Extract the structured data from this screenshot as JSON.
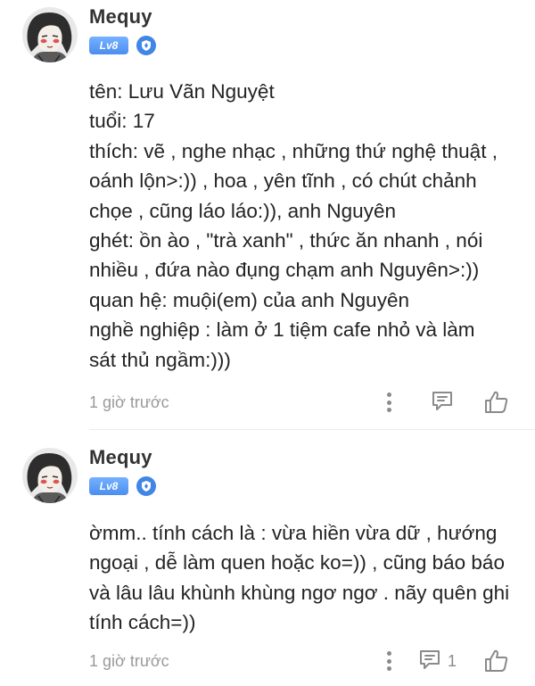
{
  "comments": [
    {
      "username": "Mequy",
      "level_badge": "Lv8",
      "lines": [
        "tên: Lưu Vãn Nguyệt",
        "tuổi: 17",
        "thích: vẽ , nghe nhạc , những thứ nghệ thuật ,",
        "oánh lộn>:)) , hoa , yên tĩnh , có chút chảnh",
        "chọe , cũng láo láo:)), anh Nguyên",
        "ghét: ồn ào , \"trà xanh\" , thức ăn nhanh , nói",
        "nhiều , đứa nào đụng chạm anh Nguyên>:))",
        "quan hệ: muội(em) của anh Nguyên",
        "nghề nghiệp : làm ở 1 tiệm cafe nhỏ và làm",
        "sát thủ ngầm:)))"
      ],
      "timestamp": "1 giờ trước",
      "reply_count": ""
    },
    {
      "username": "Mequy",
      "level_badge": "Lv8",
      "lines": [
        "ờmm.. tính cách là : vừa hiền vừa dữ , hướng",
        "ngoại , dễ làm quen hoặc ko=)) , cũng báo báo",
        "và lâu lâu khùnh khùng ngơ ngơ . nãy quên ghi",
        "tính cách=))"
      ],
      "timestamp": "1 giờ trước",
      "reply_count": "1"
    }
  ],
  "icons": {
    "more": "more-vertical-icon",
    "reply": "comment-reply-icon",
    "like": "thumbs-up-icon",
    "verified": "shield-icon"
  },
  "colors": {
    "level_badge": "#4c8ef0",
    "shield_badge": "#3f86e6",
    "text": "#232323",
    "muted": "#9a9a9a"
  }
}
